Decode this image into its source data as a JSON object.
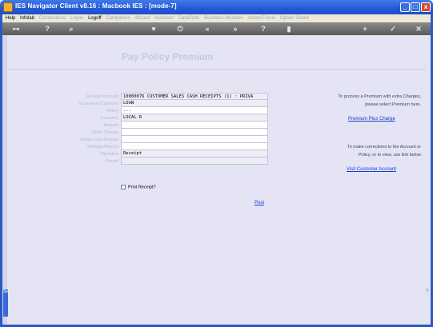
{
  "window": {
    "title": "IES Navigator Client v8.16 : Macbook IES :      [mode-7]",
    "buttons": {
      "min": "_",
      "max": "□",
      "close": "x"
    }
  },
  "menu": [
    {
      "label": "Help",
      "enabled": true
    },
    {
      "label": "Infolab",
      "enabled": true
    },
    {
      "label": "Connections",
      "enabled": false
    },
    {
      "label": "Logon",
      "enabled": false
    },
    {
      "label": "Logoff",
      "enabled": true
    },
    {
      "label": "Companies",
      "enabled": false
    },
    {
      "label": "Wizard",
      "enabled": false
    },
    {
      "label": "Assistant",
      "enabled": false
    },
    {
      "label": "DataPorts",
      "enabled": false
    },
    {
      "label": "Business Modules",
      "enabled": false
    },
    {
      "label": "Action Focus",
      "enabled": false
    },
    {
      "label": "Option Select",
      "enabled": false
    }
  ],
  "toolbar": {
    "key": "⊶",
    "help": "?",
    "search": "⌕",
    "heart": "♥",
    "power": "⏻",
    "rewind": "«",
    "forward": "»",
    "flag": "?",
    "stop": "▮",
    "add": "+",
    "check": "✓",
    "close": "✕"
  },
  "form": {
    "title": "Pay Policy Premium",
    "labels": [
      "Receipt Account",
      "Insurance Customer",
      "Policy",
      "Currency",
      "Amount",
      "Other Charge",
      "Senior Cntr Amount",
      "Receipt Amount",
      "Narrative",
      "Period"
    ],
    "values": [
      "10000076 CUSTOMER SALES CASH RECEIPTS (1) : PRIVA",
      "LOUW",
      "...",
      "LOCAL R",
      "",
      "",
      "",
      "",
      "Receipt",
      ""
    ],
    "print_receipt_label": "Print Receipt?",
    "post_label": "Post"
  },
  "info": {
    "premium_text_1": "To process a Premium with extra Charges,",
    "premium_text_2": "please select Premium here.",
    "premium_link": "Premium Plus Charge",
    "account_text_1": "To make corrections to the Account or",
    "account_text_2": "Policy, or to view, use link below",
    "account_link": "Visit Customer Account"
  },
  "side": {
    "tab_label": "Sel"
  }
}
